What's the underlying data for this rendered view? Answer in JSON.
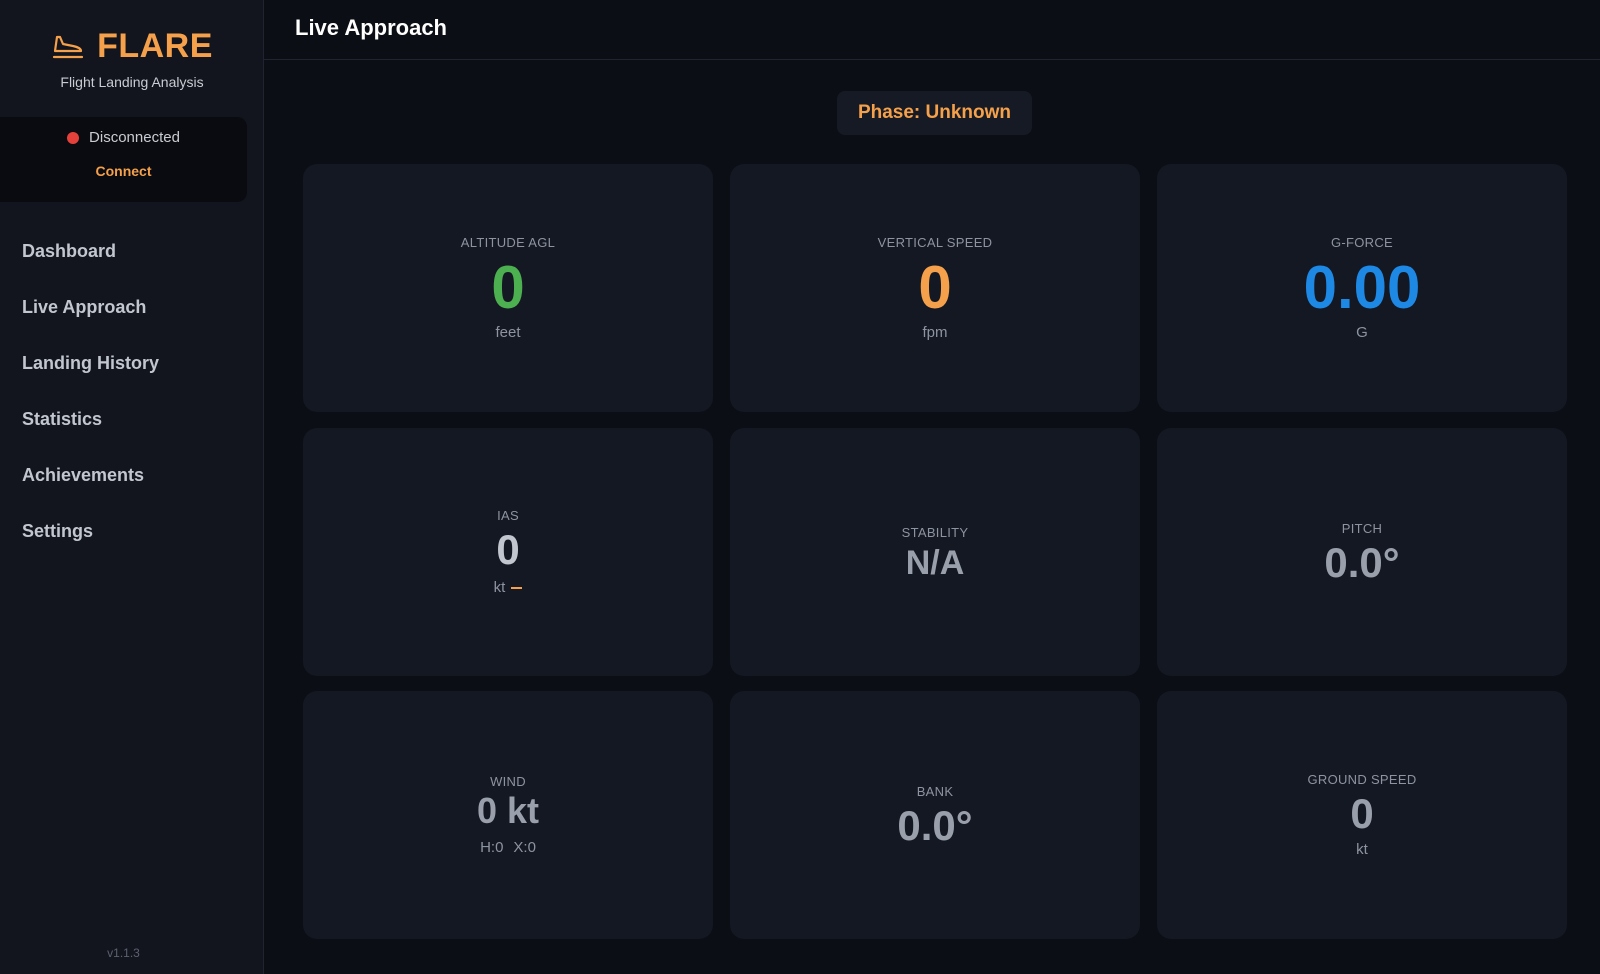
{
  "brand": {
    "title": "FLARE",
    "subtitle": "Flight Landing Analysis",
    "accent": "#f5a04a"
  },
  "connection": {
    "status": "Disconnected",
    "status_color": "#e5413b",
    "connect_label": "Connect"
  },
  "nav": {
    "items": [
      {
        "label": "Dashboard"
      },
      {
        "label": "Live Approach"
      },
      {
        "label": "Landing History"
      },
      {
        "label": "Statistics"
      },
      {
        "label": "Achievements"
      },
      {
        "label": "Settings"
      }
    ],
    "active": "Live Approach"
  },
  "version": "v1.1.3",
  "header": {
    "title": "Live Approach"
  },
  "phase": {
    "text": "Phase: Unknown"
  },
  "cards": {
    "altitude": {
      "label": "ALTITUDE AGL",
      "value": "0",
      "unit": "feet",
      "color": "#4caf50"
    },
    "vertical_speed": {
      "label": "VERTICAL SPEED",
      "value": "0",
      "unit": "fpm",
      "color": "#f5a04a"
    },
    "gforce": {
      "label": "G-FORCE",
      "value": "0.00",
      "unit": "G",
      "color": "#1e88e5"
    },
    "ias": {
      "label": "IAS",
      "value": "0",
      "unit": "kt",
      "trend_icon": "dash-trend-icon"
    },
    "stability": {
      "label": "STABILITY",
      "value": "N/A"
    },
    "pitch": {
      "label": "PITCH",
      "value": "0.0°"
    },
    "wind": {
      "label": "WIND",
      "value": "0 kt",
      "headwind": "H:0",
      "crosswind": "X:0"
    },
    "bank": {
      "label": "BANK",
      "value": "0.0°"
    },
    "ground_speed": {
      "label": "GROUND SPEED",
      "value": "0",
      "unit": "kt"
    }
  }
}
